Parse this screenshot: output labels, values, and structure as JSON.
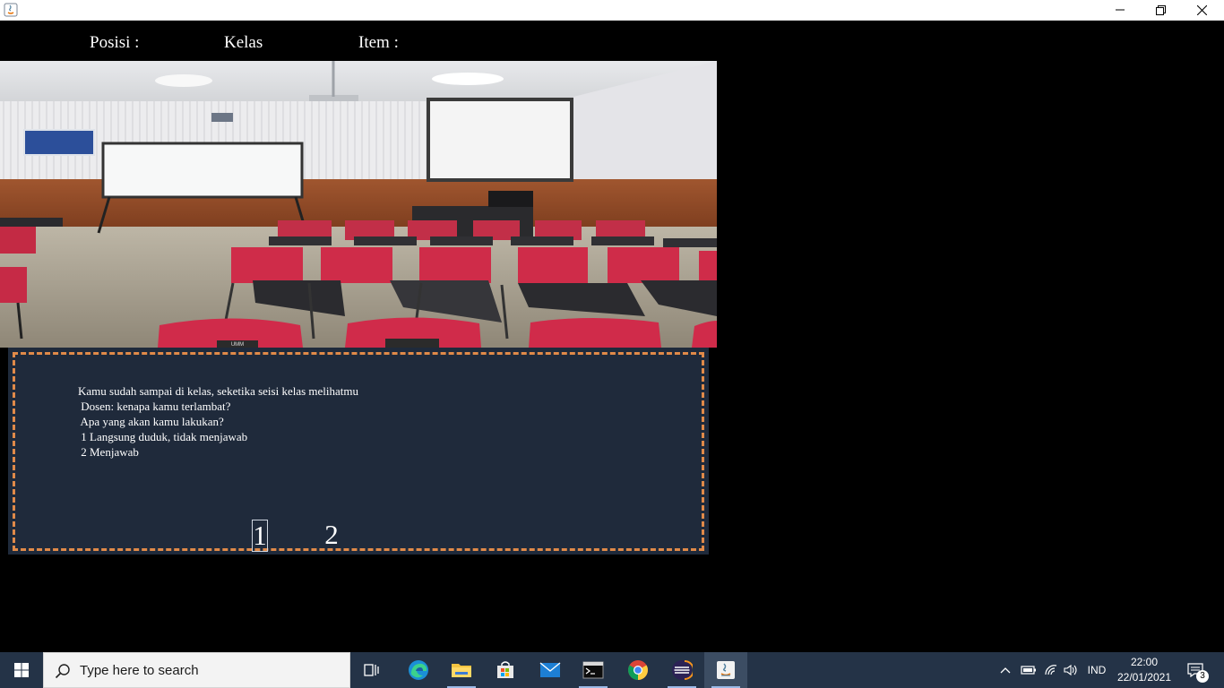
{
  "window": {
    "controls": [
      "minimize-icon",
      "restore-icon",
      "close-icon"
    ]
  },
  "status": {
    "posisi_label": "Posisi :",
    "kelas_label": "Kelas",
    "item_label": "Item :"
  },
  "scene": {
    "poster_text": "",
    "chair_label": "UMM"
  },
  "dialog": {
    "text": "Kamu sudah sampai di kelas, seketika seisi kelas melihatmu\n Dosen: kenapa kamu terlambat?\n Apa yang akan kamu lakukan?\n 1 Langsung duduk, tidak menjawab\n 2 Menjawab",
    "choices": [
      "1",
      "2"
    ],
    "border_color": "#e08a49",
    "background": "#1f2a3b"
  },
  "taskbar": {
    "search_placeholder": "Type here to search",
    "apps": [
      "task-view-icon",
      "edge-icon",
      "file-explorer-icon",
      "store-icon",
      "mail-icon",
      "terminal-icon",
      "chrome-icon",
      "eclipse-icon",
      "java-icon"
    ],
    "language": "IND",
    "time": "22:00",
    "date": "22/01/2021",
    "notification_count": "3"
  }
}
